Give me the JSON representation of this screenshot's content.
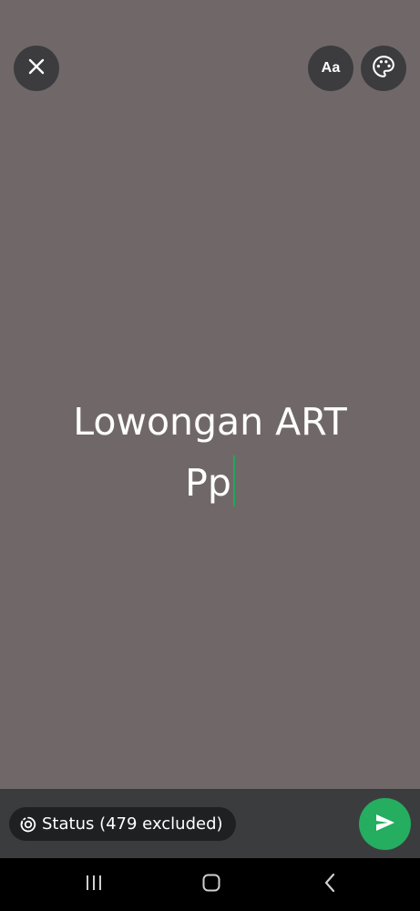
{
  "editor": {
    "line1": "Lowongan ART",
    "line2": "Pp",
    "background_color": "#706868",
    "caret_color": "#25a55c"
  },
  "toolbar": {
    "close_icon": "close-icon",
    "font_label": "Aa",
    "palette_icon": "palette-icon"
  },
  "bottom": {
    "audience_label": "Status (479 excluded)",
    "audience_icon": "status-icon",
    "send_icon": "send-icon",
    "send_color": "#25ad60"
  },
  "nav": {
    "recents_icon": "recents-icon",
    "home_icon": "home-icon",
    "back_icon": "back-icon"
  }
}
